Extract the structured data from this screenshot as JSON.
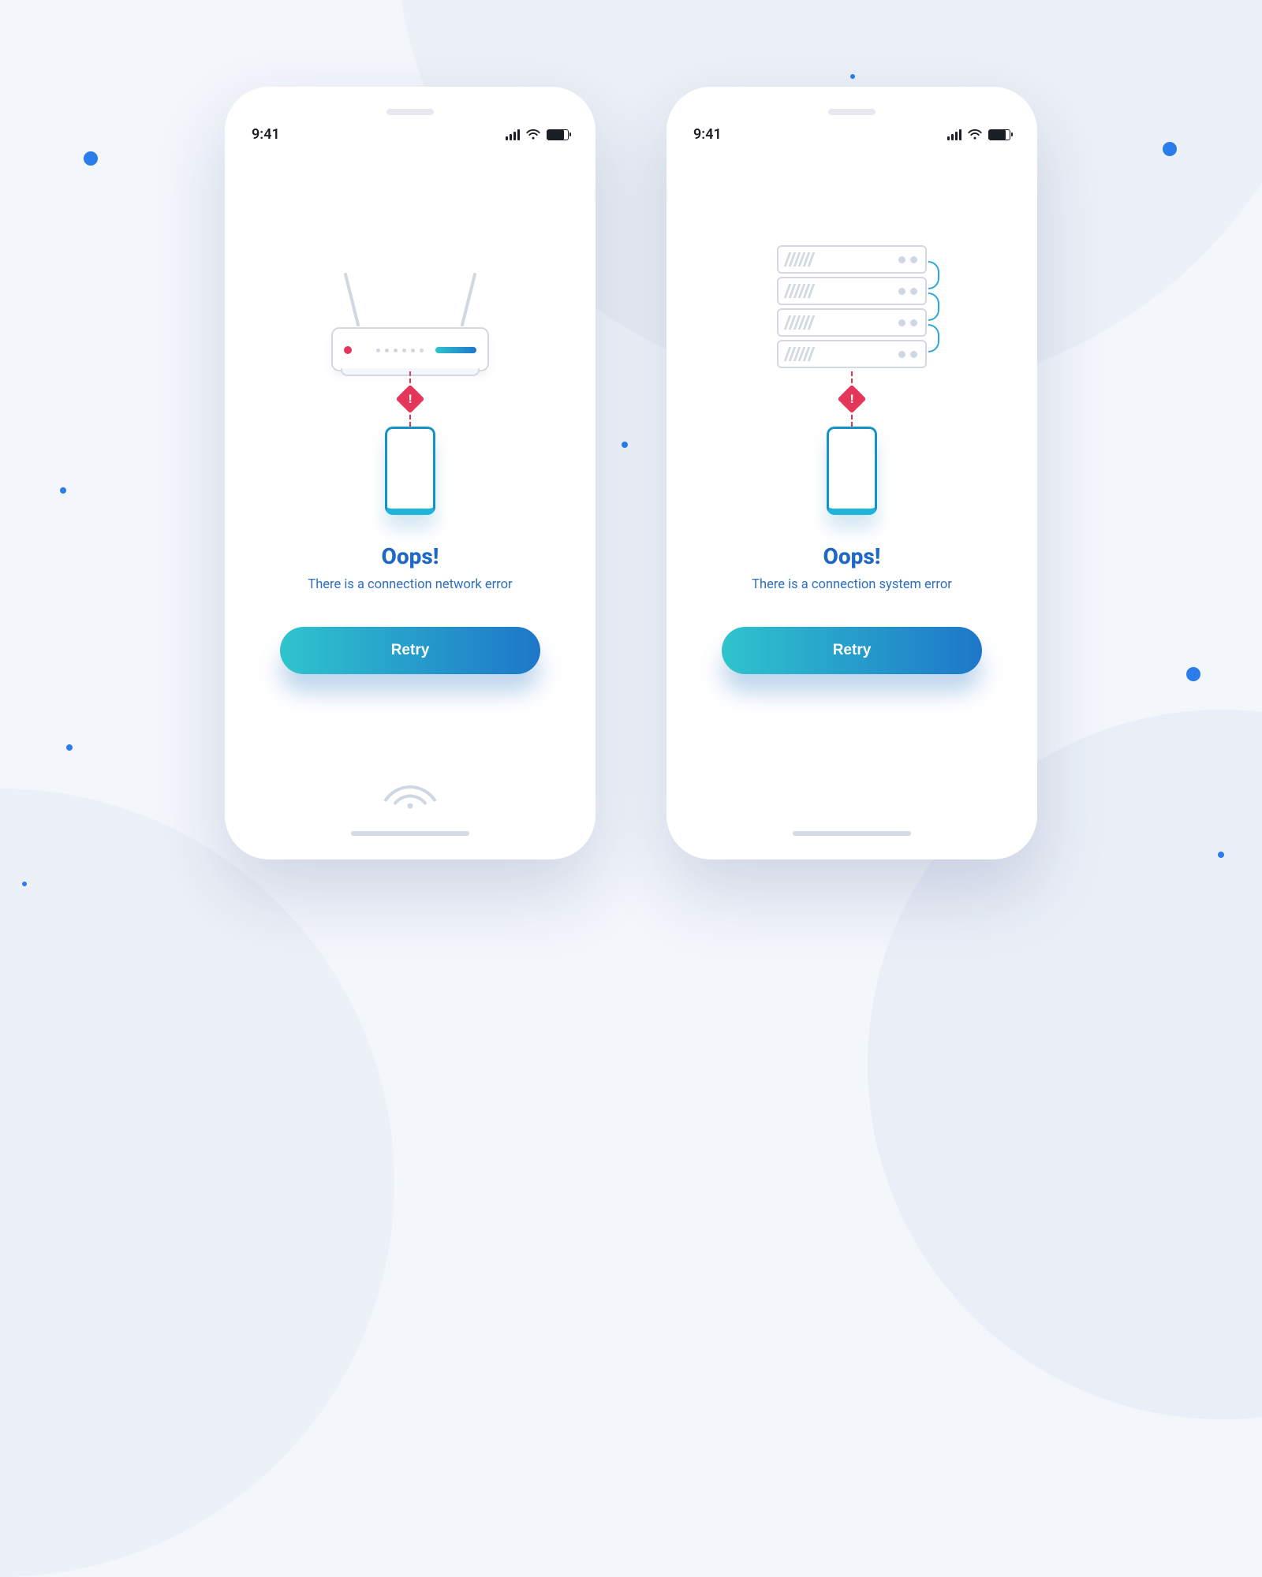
{
  "status": {
    "time": "9:41"
  },
  "screens": [
    {
      "title": "Oops!",
      "subtitle": "There is a connection network error",
      "button": "Retry"
    },
    {
      "title": "Oops!",
      "subtitle": "There is a connection system error",
      "button": "Retry"
    }
  ]
}
